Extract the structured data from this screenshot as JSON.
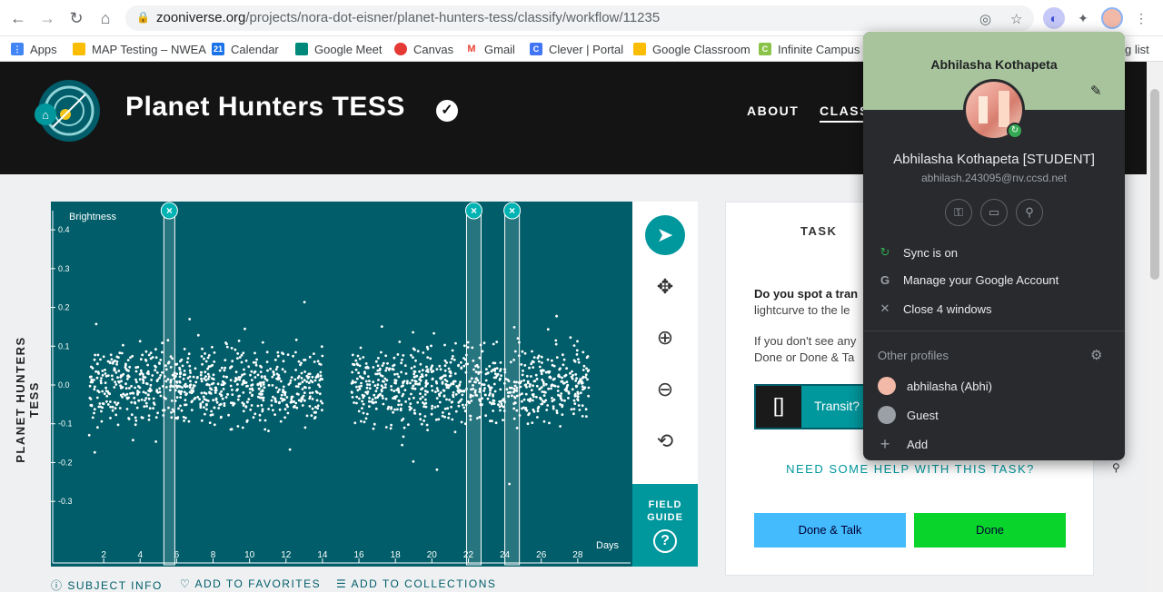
{
  "browser": {
    "url_host": "zooniverse.org",
    "url_path": "/projects/nora-dot-eisner/planet-hunters-tess/classify/workflow/11235",
    "bookmarks": [
      {
        "label": "Apps",
        "color": "#4285f4"
      },
      {
        "label": "MAP Testing – NWEA",
        "color": "#fbbc04"
      },
      {
        "label": "Calendar",
        "color": "#1a73e8",
        "glyph": "21"
      },
      {
        "label": "Google Meet",
        "color": "#00897b"
      },
      {
        "label": "Canvas",
        "color": "#e53935"
      },
      {
        "label": "Gmail",
        "color": "#ea4335",
        "glyph": "M"
      },
      {
        "label": "Clever | Portal",
        "color": "#4274f6",
        "glyph": "C"
      },
      {
        "label": "Google Classroom",
        "color": "#fbbc04"
      },
      {
        "label": "Infinite Campus",
        "color": "#8bc34a",
        "glyph": "C"
      }
    ],
    "reading_list_partial": "g list"
  },
  "site": {
    "title": "Planet Hunters TESS",
    "nav": [
      "ABOUT",
      "CLASS"
    ]
  },
  "chart_data": {
    "type": "scatter",
    "ylabel": "Brightness",
    "xlabel": "Days",
    "side_label": "PLANET HUNTERS TESS",
    "x_ticks": [
      2,
      4,
      6,
      8,
      10,
      12,
      14,
      16,
      18,
      20,
      22,
      24,
      26,
      28
    ],
    "y_ticks": [
      0.4,
      0.3,
      0.2,
      0.1,
      0.0,
      -0.1,
      -0.2,
      -0.3
    ],
    "ylim": [
      -0.44,
      0.44
    ],
    "xlim": [
      0.6,
      30
    ],
    "gap": [
      14,
      15.5
    ],
    "marks": [
      {
        "x_start": 5.3,
        "x_end": 5.9
      },
      {
        "x_start": 21.9,
        "x_end": 22.7
      },
      {
        "x_start": 24.0,
        "x_end": 24.8
      }
    ]
  },
  "tools": {
    "field_guide": "FIELD GUIDE"
  },
  "task": {
    "tab": "TASK",
    "question_bold": "Do you spot a tran",
    "question_rest": "lightcurve to the le",
    "hint_line1": "If you don't see any",
    "hint_line2": "Done or Done & Ta",
    "transit_label": "Transit?",
    "help": "NEED SOME HELP WITH THIS TASK?",
    "done_talk": "Done & Talk",
    "done": "Done"
  },
  "subject_links": [
    "SUBJECT INFO",
    "ADD TO FAVORITES",
    "ADD TO COLLECTIONS"
  ],
  "profile": {
    "name": "Abhilasha Kothapeta",
    "full_name": "Abhilasha Kothapeta [STUDENT]",
    "email": "abhilash.243095@nv.ccsd.net",
    "sync": "Sync is on",
    "manage": "Manage your Google Account",
    "close": "Close 4 windows",
    "other_profiles": "Other profiles",
    "profiles": [
      "abhilasha (Abhi)",
      "Guest",
      "Add"
    ]
  }
}
